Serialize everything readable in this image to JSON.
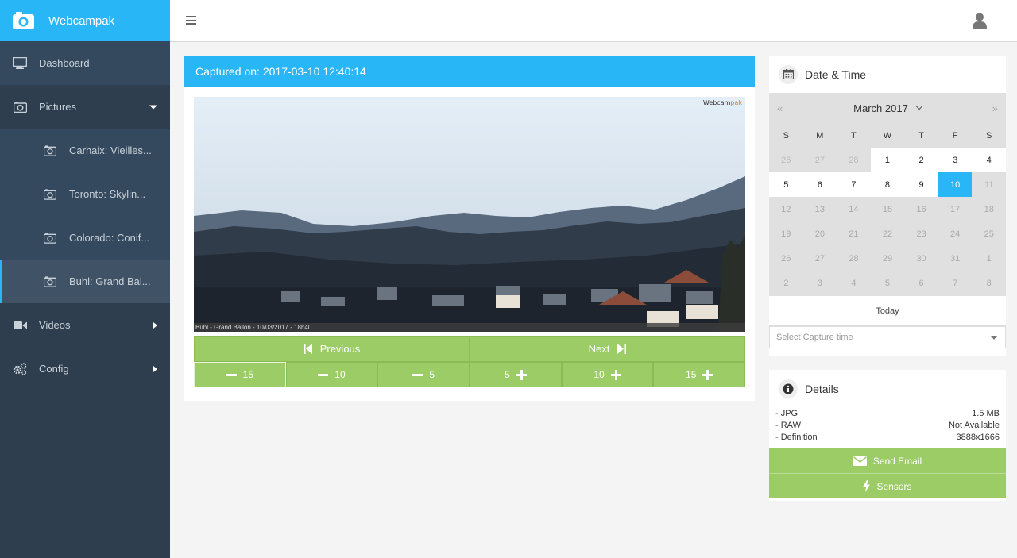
{
  "app": {
    "title": "Webcampak"
  },
  "sidebar": {
    "items": [
      {
        "label": "Dashboard",
        "icon": "monitor-icon"
      },
      {
        "label": "Pictures",
        "icon": "camera-icon"
      },
      {
        "label": "Videos",
        "icon": "video-icon"
      },
      {
        "label": "Config",
        "icon": "gears-icon"
      }
    ],
    "sub_items": [
      {
        "label": "Carhaix: Vieilles..."
      },
      {
        "label": "Toronto: Skylin..."
      },
      {
        "label": "Colorado: Conif..."
      },
      {
        "label": "Buhl: Grand Bal..."
      }
    ]
  },
  "picture": {
    "header": "Captured on: 2017-03-10 12:40:14",
    "watermark_left": "Webcam",
    "watermark_right": "pak",
    "stamp": "Buhl - Grand Ballon -  10/03/2017 - 18h40"
  },
  "navigation": {
    "previous": "Previous",
    "next": "Next",
    "steps": [
      "15",
      "10",
      "5",
      "5",
      "10",
      "15"
    ]
  },
  "datetime": {
    "title": "Date & Time",
    "month": "March 2017",
    "prev": "«",
    "next": "»",
    "weekdays": [
      "S",
      "M",
      "T",
      "W",
      "T",
      "F",
      "S"
    ],
    "weeks": [
      [
        "26",
        "27",
        "28",
        "1",
        "2",
        "3",
        "4"
      ],
      [
        "5",
        "6",
        "7",
        "8",
        "9",
        "10",
        "11"
      ],
      [
        "12",
        "13",
        "14",
        "15",
        "16",
        "17",
        "18"
      ],
      [
        "19",
        "20",
        "21",
        "22",
        "23",
        "24",
        "25"
      ],
      [
        "26",
        "27",
        "28",
        "29",
        "30",
        "31",
        "1"
      ],
      [
        "2",
        "3",
        "4",
        "5",
        "6",
        "7",
        "8"
      ]
    ],
    "selected_day": "10",
    "today": "Today",
    "capture_time_placeholder": "Select Capture time"
  },
  "details": {
    "title": "Details",
    "rows": [
      {
        "label": "- JPG",
        "value": "1.5 MB"
      },
      {
        "label": "- RAW",
        "value": "Not Available"
      },
      {
        "label": "- Definition",
        "value": "3888x1666"
      }
    ],
    "send_email": "Send Email",
    "sensors": "Sensors"
  },
  "colors": {
    "accent": "#29b6f6",
    "sidebar": "#2e3e4e",
    "button_green": "#9ccc65"
  }
}
